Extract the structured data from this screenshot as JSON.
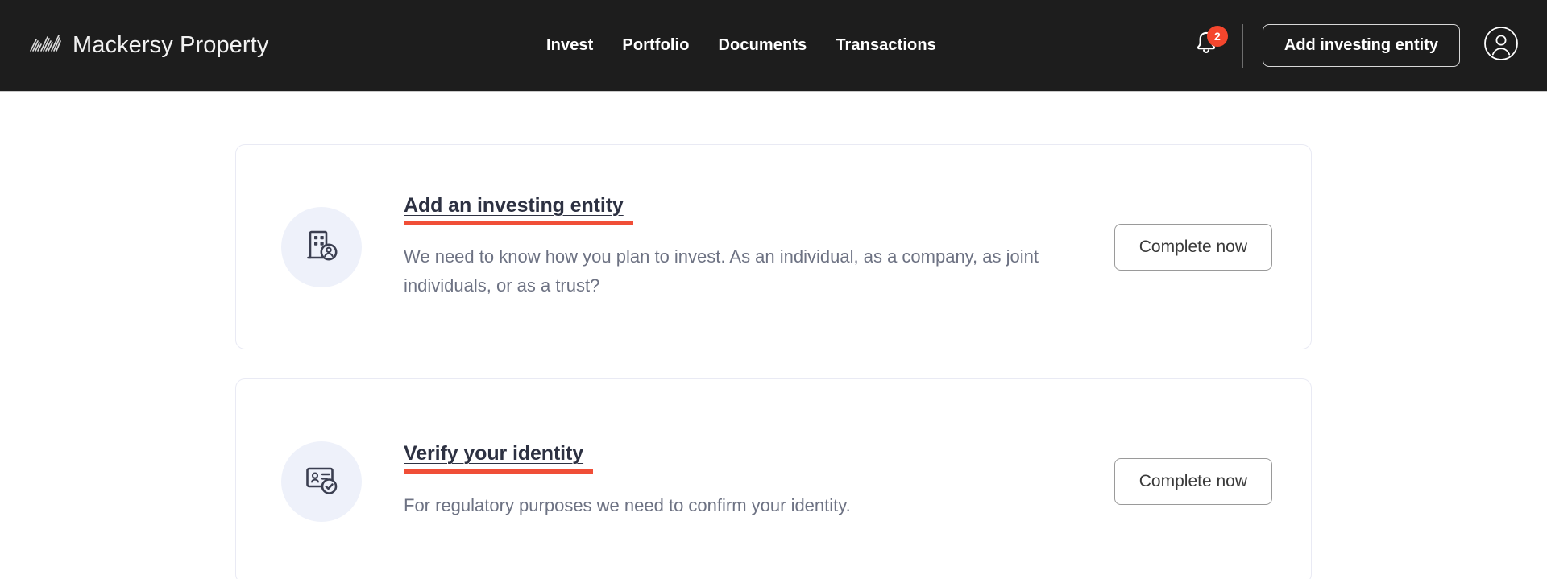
{
  "header": {
    "brand": {
      "name": "Mackersy Property",
      "mark_icon": "diagonal-stripes-logo-mark"
    },
    "nav": [
      {
        "label": "Invest",
        "name": "nav-item-invest"
      },
      {
        "label": "Portfolio",
        "name": "nav-item-portfolio"
      },
      {
        "label": "Documents",
        "name": "nav-item-documents"
      },
      {
        "label": "Transactions",
        "name": "nav-item-transactions"
      }
    ],
    "notifications": {
      "icon": "bell-icon",
      "count": "2"
    },
    "add_entity_button": "Add investing entity",
    "account_icon": "user-circle-icon"
  },
  "main": {
    "tasks": [
      {
        "icon": "building-user-icon",
        "title": "Add an investing entity",
        "description": "We need to know how you plan to invest. As an individual, as a company, as joint individuals, or as a trust?",
        "action_label": "Complete now"
      },
      {
        "icon": "id-card-check-icon",
        "title": "Verify your identity",
        "description": "For regulatory purposes we need to confirm your identity.",
        "action_label": "Complete now"
      }
    ]
  },
  "colors": {
    "header_bg": "#1d1d1d",
    "accent_underline": "#f04e37",
    "badge_bg": "#f4462d",
    "icon_circle_bg": "#eef1fa",
    "card_border": "#e9eaf4",
    "title_text": "#2d3142",
    "body_text": "#6d7283"
  }
}
